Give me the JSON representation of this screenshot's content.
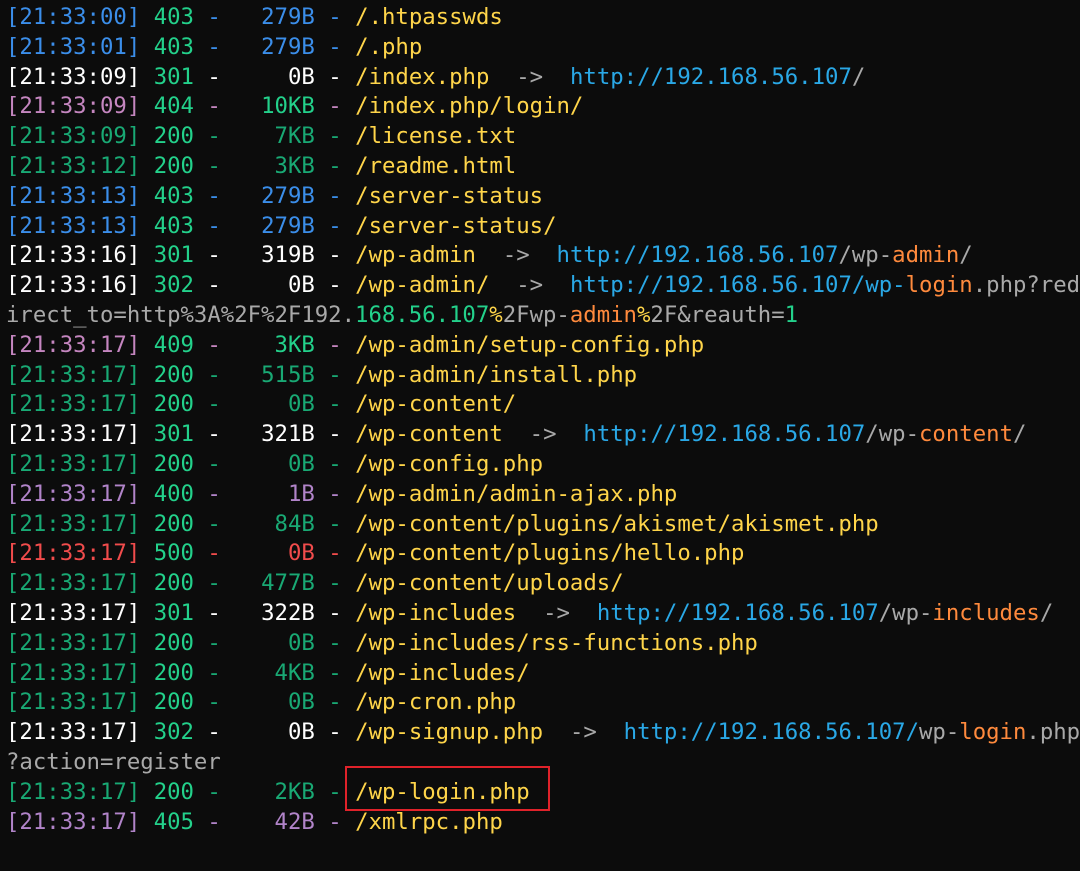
{
  "colors": {
    "background": "#0c0c0c",
    "gray": "#a9a9a9",
    "yellow": "#ffd54a",
    "cyan": "#2aa8e6",
    "orange": "#ff8a3d",
    "green": "#23d18b",
    "dim": "#7a7a7a",
    "highlight_box": "#e0222a"
  },
  "status_colors": {
    "200": {
      "ts": "#19a974",
      "code": "#23d18b",
      "size": "#19a974"
    },
    "301": {
      "ts": "#ffffff",
      "code": "#23d18b",
      "size": "#ffffff"
    },
    "302": {
      "ts": "#ffffff",
      "code": "#23d18b",
      "size": "#ffffff"
    },
    "400": {
      "ts": "#b184c9",
      "code": "#23d18b",
      "size": "#b184c9"
    },
    "403": {
      "ts": "#3b8eea",
      "code": "#23d18b",
      "size": "#3b8eea"
    },
    "404": {
      "ts": "#c586c0",
      "code": "#23d18b",
      "size": "#23d18b"
    },
    "405": {
      "ts": "#b184c9",
      "code": "#23d18b",
      "size": "#b184c9"
    },
    "409": {
      "ts": "#c586c0",
      "code": "#23d18b",
      "size": "#23d18b"
    },
    "500": {
      "ts": "#f14c4c",
      "code": "#23d18b",
      "size": "#f14c4c"
    }
  },
  "lines": [
    {
      "type": "entry",
      "time": "[21:33:00]",
      "code": "403",
      "size": "279B",
      "path": "/.htpasswds"
    },
    {
      "type": "entry",
      "time": "[21:33:01]",
      "code": "403",
      "size": "279B",
      "path": "/.php"
    },
    {
      "type": "entry",
      "time": "[21:33:09]",
      "code": "301",
      "size": "0B",
      "path": "/index.php",
      "arrow": "->",
      "redirect": [
        {
          "text": "http://192.168.56.107",
          "color": "cyan"
        },
        {
          "text": "/",
          "color": "gray"
        }
      ]
    },
    {
      "type": "entry",
      "time": "[21:33:09]",
      "code": "404",
      "size": "10KB",
      "path": "/index.php/login/"
    },
    {
      "type": "entry",
      "time": "[21:33:09]",
      "code": "200",
      "size": "7KB",
      "path": "/license.txt"
    },
    {
      "type": "entry",
      "time": "[21:33:12]",
      "code": "200",
      "size": "3KB",
      "path": "/readme.html"
    },
    {
      "type": "entry",
      "time": "[21:33:13]",
      "code": "403",
      "size": "279B",
      "path": "/server-status"
    },
    {
      "type": "entry",
      "time": "[21:33:13]",
      "code": "403",
      "size": "279B",
      "path": "/server-status/"
    },
    {
      "type": "entry",
      "time": "[21:33:16]",
      "code": "301",
      "size": "319B",
      "path": "/wp-admin",
      "arrow": "->",
      "redirect": [
        {
          "text": "http://192.168.56.107",
          "color": "cyan"
        },
        {
          "text": "/wp-",
          "color": "gray"
        },
        {
          "text": "admin",
          "color": "orange"
        },
        {
          "text": "/",
          "color": "gray"
        }
      ]
    },
    {
      "type": "entry",
      "time": "[21:33:16]",
      "code": "302",
      "size": "0B",
      "path": "/wp-admin/",
      "arrow": "->",
      "redirect": [
        {
          "text": "http://192.168.56.107",
          "color": "cyan"
        },
        {
          "text": "/",
          "color": "cyan"
        },
        {
          "text": "wp-",
          "color": "cyan"
        },
        {
          "text": "login",
          "color": "orange"
        },
        {
          "text": ".php?red",
          "color": "gray"
        }
      ]
    },
    {
      "type": "wrap",
      "segments": [
        {
          "text": "irect_to=http%3A%2F%2F192.",
          "color": "gray"
        },
        {
          "text": "168.56.107",
          "color": "green"
        },
        {
          "text": "%",
          "color": "yellow"
        },
        {
          "text": "2Fwp-",
          "color": "gray"
        },
        {
          "text": "admin",
          "color": "orange"
        },
        {
          "text": "%",
          "color": "yellow"
        },
        {
          "text": "2F&reauth=",
          "color": "gray"
        },
        {
          "text": "1",
          "color": "green"
        }
      ]
    },
    {
      "type": "entry",
      "time": "[21:33:17]",
      "code": "409",
      "size": "3KB",
      "path": "/wp-admin/setup-config.php"
    },
    {
      "type": "entry",
      "time": "[21:33:17]",
      "code": "200",
      "size": "515B",
      "path": "/wp-admin/install.php"
    },
    {
      "type": "entry",
      "time": "[21:33:17]",
      "code": "200",
      "size": "0B",
      "path": "/wp-content/"
    },
    {
      "type": "entry",
      "time": "[21:33:17]",
      "code": "301",
      "size": "321B",
      "path": "/wp-content",
      "arrow": "->",
      "redirect": [
        {
          "text": "http://192.168.56.107",
          "color": "cyan"
        },
        {
          "text": "/wp-",
          "color": "gray"
        },
        {
          "text": "content",
          "color": "orange"
        },
        {
          "text": "/",
          "color": "gray"
        }
      ]
    },
    {
      "type": "entry",
      "time": "[21:33:17]",
      "code": "200",
      "size": "0B",
      "path": "/wp-config.php"
    },
    {
      "type": "entry",
      "time": "[21:33:17]",
      "code": "400",
      "size": "1B",
      "path": "/wp-admin/admin-ajax.php"
    },
    {
      "type": "entry",
      "time": "[21:33:17]",
      "code": "200",
      "size": "84B",
      "path": "/wp-content/plugins/akismet/akismet.php"
    },
    {
      "type": "entry",
      "time": "[21:33:17]",
      "code": "500",
      "size": "0B",
      "path": "/wp-content/plugins/hello.php"
    },
    {
      "type": "entry",
      "time": "[21:33:17]",
      "code": "200",
      "size": "477B",
      "path": "/wp-content/uploads/"
    },
    {
      "type": "entry",
      "time": "[21:33:17]",
      "code": "301",
      "size": "322B",
      "path": "/wp-includes",
      "arrow": "->",
      "redirect": [
        {
          "text": "http://192.168.56.107",
          "color": "cyan"
        },
        {
          "text": "/wp-",
          "color": "gray"
        },
        {
          "text": "includes",
          "color": "orange"
        },
        {
          "text": "/",
          "color": "gray"
        }
      ]
    },
    {
      "type": "entry",
      "time": "[21:33:17]",
      "code": "200",
      "size": "0B",
      "path": "/wp-includes/rss-functions.php"
    },
    {
      "type": "entry",
      "time": "[21:33:17]",
      "code": "200",
      "size": "4KB",
      "path": "/wp-includes/"
    },
    {
      "type": "entry",
      "time": "[21:33:17]",
      "code": "200",
      "size": "0B",
      "path": "/wp-cron.php"
    },
    {
      "type": "entry",
      "time": "[21:33:17]",
      "code": "302",
      "size": "0B",
      "path": "/wp-signup.php",
      "arrow": "->",
      "redirect": [
        {
          "text": "http://192.168.56.107",
          "color": "cyan"
        },
        {
          "text": "/",
          "color": "cyan"
        },
        {
          "text": "wp-",
          "color": "gray"
        },
        {
          "text": "login",
          "color": "orange"
        },
        {
          "text": ".php",
          "color": "gray"
        }
      ]
    },
    {
      "type": "wrap",
      "segments": [
        {
          "text": "?action=register",
          "color": "gray"
        }
      ]
    },
    {
      "type": "entry",
      "time": "[21:33:17]",
      "code": "200",
      "size": "2KB",
      "path": "/wp-login.php",
      "highlight": true
    },
    {
      "type": "entry",
      "time": "[21:33:17]",
      "code": "405",
      "size": "42B",
      "path": "/xmlrpc.php"
    }
  ]
}
